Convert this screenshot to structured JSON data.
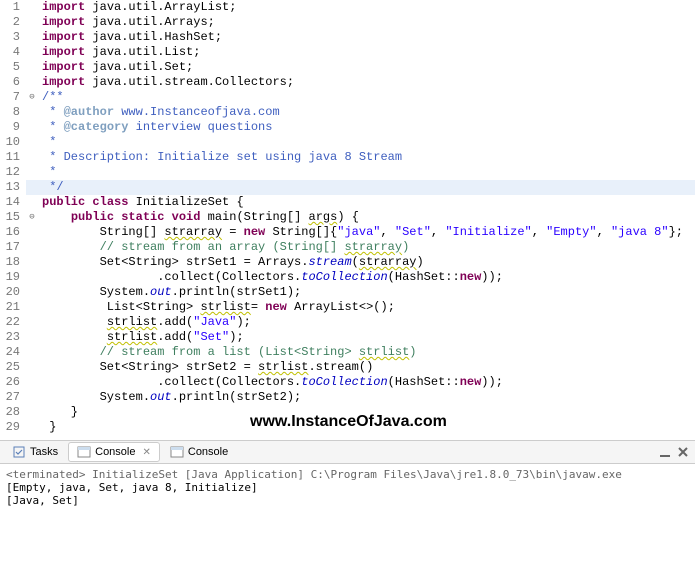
{
  "lines": [
    {
      "n": 1,
      "fold": "",
      "cls": "",
      "parts": [
        {
          "c": "kw",
          "t": "import"
        },
        {
          "c": "",
          "t": " java.util.ArrayList;"
        }
      ]
    },
    {
      "n": 2,
      "fold": "",
      "cls": "",
      "parts": [
        {
          "c": "kw",
          "t": "import"
        },
        {
          "c": "",
          "t": " java.util.Arrays;"
        }
      ]
    },
    {
      "n": 3,
      "fold": "",
      "cls": "",
      "parts": [
        {
          "c": "kw",
          "t": "import"
        },
        {
          "c": "",
          "t": " java.util.HashSet;"
        }
      ]
    },
    {
      "n": 4,
      "fold": "",
      "cls": "",
      "parts": [
        {
          "c": "kw",
          "t": "import"
        },
        {
          "c": "",
          "t": " java.util.List;"
        }
      ]
    },
    {
      "n": 5,
      "fold": "",
      "cls": "",
      "parts": [
        {
          "c": "kw",
          "t": "import"
        },
        {
          "c": "",
          "t": " java.util.Set;"
        }
      ]
    },
    {
      "n": 6,
      "fold": "",
      "cls": "",
      "parts": [
        {
          "c": "kw",
          "t": "import"
        },
        {
          "c": "",
          "t": " java.util.stream.Collectors;"
        }
      ]
    },
    {
      "n": 7,
      "fold": "⊖",
      "cls": "",
      "parts": [
        {
          "c": "doc",
          "t": "/**"
        }
      ]
    },
    {
      "n": 8,
      "fold": "",
      "cls": "",
      "parts": [
        {
          "c": "doc",
          "t": " * "
        },
        {
          "c": "doctag",
          "t": "@author"
        },
        {
          "c": "doc",
          "t": " www.Instanceofjava.com"
        }
      ]
    },
    {
      "n": 9,
      "fold": "",
      "cls": "",
      "parts": [
        {
          "c": "doc",
          "t": " * "
        },
        {
          "c": "doctag",
          "t": "@category"
        },
        {
          "c": "doc",
          "t": " interview questions"
        }
      ]
    },
    {
      "n": 10,
      "fold": "",
      "cls": "",
      "parts": [
        {
          "c": "doc",
          "t": " * "
        }
      ]
    },
    {
      "n": 11,
      "fold": "",
      "cls": "",
      "parts": [
        {
          "c": "doc",
          "t": " * Description: Initialize set using java 8 Stream"
        }
      ]
    },
    {
      "n": 12,
      "fold": "",
      "cls": "",
      "parts": [
        {
          "c": "doc",
          "t": " *"
        }
      ]
    },
    {
      "n": 13,
      "fold": "",
      "cls": "hl",
      "parts": [
        {
          "c": "doc",
          "t": " */"
        }
      ]
    },
    {
      "n": 14,
      "fold": "",
      "cls": "",
      "parts": [
        {
          "c": "kw",
          "t": "public"
        },
        {
          "c": "",
          "t": " "
        },
        {
          "c": "kw",
          "t": "class"
        },
        {
          "c": "",
          "t": " InitializeSet {"
        }
      ]
    },
    {
      "n": 15,
      "fold": "⊖",
      "cls": "",
      "parts": [
        {
          "c": "",
          "t": "    "
        },
        {
          "c": "kw",
          "t": "public"
        },
        {
          "c": "",
          "t": " "
        },
        {
          "c": "kw",
          "t": "static"
        },
        {
          "c": "",
          "t": " "
        },
        {
          "c": "kw",
          "t": "void"
        },
        {
          "c": "",
          "t": " main(String[] "
        },
        {
          "c": "squig",
          "t": "args"
        },
        {
          "c": "",
          "t": ") {"
        }
      ]
    },
    {
      "n": 16,
      "fold": "",
      "cls": "",
      "parts": [
        {
          "c": "",
          "t": "        String[] "
        },
        {
          "c": "squig",
          "t": "strarray"
        },
        {
          "c": "",
          "t": " = "
        },
        {
          "c": "kw",
          "t": "new"
        },
        {
          "c": "",
          "t": " String[]{"
        },
        {
          "c": "str",
          "t": "\"java\""
        },
        {
          "c": "",
          "t": ", "
        },
        {
          "c": "str",
          "t": "\"Set\""
        },
        {
          "c": "",
          "t": ", "
        },
        {
          "c": "str",
          "t": "\"Initialize\""
        },
        {
          "c": "",
          "t": ", "
        },
        {
          "c": "str",
          "t": "\"Empty\""
        },
        {
          "c": "",
          "t": ", "
        },
        {
          "c": "str",
          "t": "\"java 8\""
        },
        {
          "c": "",
          "t": "};"
        }
      ]
    },
    {
      "n": 17,
      "fold": "",
      "cls": "",
      "parts": [
        {
          "c": "",
          "t": "        "
        },
        {
          "c": "com",
          "t": "// stream from an array (String[] "
        },
        {
          "c": "com squig",
          "t": "strarray"
        },
        {
          "c": "com",
          "t": ")"
        }
      ]
    },
    {
      "n": 18,
      "fold": "",
      "cls": "",
      "parts": [
        {
          "c": "",
          "t": "        Set<String> strSet1 = Arrays."
        },
        {
          "c": "it",
          "t": "stream"
        },
        {
          "c": "",
          "t": "("
        },
        {
          "c": "squig",
          "t": "strarray"
        },
        {
          "c": "",
          "t": ")"
        }
      ]
    },
    {
      "n": 19,
      "fold": "",
      "cls": "",
      "parts": [
        {
          "c": "",
          "t": "                .collect(Collectors."
        },
        {
          "c": "it",
          "t": "toCollection"
        },
        {
          "c": "",
          "t": "(HashSet::"
        },
        {
          "c": "kw",
          "t": "new"
        },
        {
          "c": "",
          "t": "));"
        }
      ]
    },
    {
      "n": 20,
      "fold": "",
      "cls": "",
      "parts": [
        {
          "c": "",
          "t": "        System."
        },
        {
          "c": "it",
          "t": "out"
        },
        {
          "c": "",
          "t": ".println(strSet1);"
        }
      ]
    },
    {
      "n": 21,
      "fold": "",
      "cls": "",
      "parts": [
        {
          "c": "",
          "t": "         List<String> "
        },
        {
          "c": "squig",
          "t": "strlist"
        },
        {
          "c": "",
          "t": "= "
        },
        {
          "c": "kw",
          "t": "new"
        },
        {
          "c": "",
          "t": " ArrayList<>();"
        }
      ]
    },
    {
      "n": 22,
      "fold": "",
      "cls": "",
      "parts": [
        {
          "c": "",
          "t": "         "
        },
        {
          "c": "squig",
          "t": "strlist"
        },
        {
          "c": "",
          "t": ".add("
        },
        {
          "c": "str",
          "t": "\"Java\""
        },
        {
          "c": "",
          "t": ");"
        }
      ]
    },
    {
      "n": 23,
      "fold": "",
      "cls": "",
      "parts": [
        {
          "c": "",
          "t": "         "
        },
        {
          "c": "squig",
          "t": "strlist"
        },
        {
          "c": "",
          "t": ".add("
        },
        {
          "c": "str",
          "t": "\"Set\""
        },
        {
          "c": "",
          "t": ");"
        }
      ]
    },
    {
      "n": 24,
      "fold": "",
      "cls": "",
      "parts": [
        {
          "c": "",
          "t": "        "
        },
        {
          "c": "com",
          "t": "// stream from a list (List<String> "
        },
        {
          "c": "com squig",
          "t": "strlist"
        },
        {
          "c": "com",
          "t": ")"
        }
      ]
    },
    {
      "n": 25,
      "fold": "",
      "cls": "",
      "parts": [
        {
          "c": "",
          "t": "        Set<String> strSet2 = "
        },
        {
          "c": "squig",
          "t": "strlist"
        },
        {
          "c": "",
          "t": ".stream()"
        }
      ]
    },
    {
      "n": 26,
      "fold": "",
      "cls": "",
      "parts": [
        {
          "c": "",
          "t": "                .collect(Collectors."
        },
        {
          "c": "it",
          "t": "toCollection"
        },
        {
          "c": "",
          "t": "(HashSet::"
        },
        {
          "c": "kw",
          "t": "new"
        },
        {
          "c": "",
          "t": "));"
        }
      ]
    },
    {
      "n": 27,
      "fold": "",
      "cls": "",
      "parts": [
        {
          "c": "",
          "t": "        System."
        },
        {
          "c": "it",
          "t": "out"
        },
        {
          "c": "",
          "t": ".println(strSet2);"
        }
      ]
    },
    {
      "n": 28,
      "fold": "",
      "cls": "",
      "parts": [
        {
          "c": "",
          "t": "    }"
        }
      ]
    },
    {
      "n": 29,
      "fold": "",
      "cls": "",
      "parts": [
        {
          "c": "",
          "t": " }"
        }
      ]
    }
  ],
  "watermark": "www.InstanceOfJava.com",
  "tabs": {
    "tasks": "Tasks",
    "console_active": "Console",
    "console_close": "✕",
    "console2": "Console"
  },
  "terminal": {
    "status": "<terminated> InitializeSet [Java Application] C:\\Program Files\\Java\\jre1.8.0_73\\bin\\javaw.exe",
    "out1": "[Empty, java, Set, java 8, Initialize]",
    "out2": "[Java, Set]"
  }
}
